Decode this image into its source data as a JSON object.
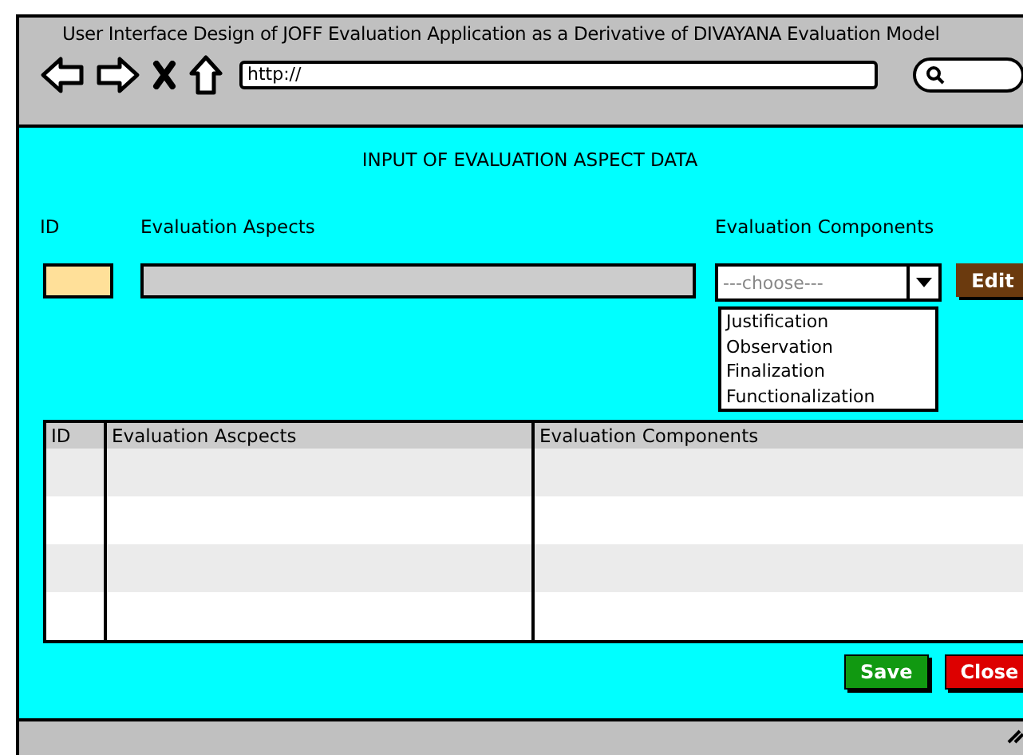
{
  "window": {
    "title": "User Interface Design of JOFF Evaluation Application as a Derivative of DIVAYANA Evaluation Model"
  },
  "browser": {
    "url": "http://"
  },
  "form": {
    "heading": "INPUT OF EVALUATION ASPECT DATA",
    "labels": [
      "ID",
      "Evaluation Aspects",
      "Evaluation Components"
    ],
    "component_select": {
      "placeholder": "---choose---",
      "expanded": true,
      "options": [
        "Justification",
        "Observation",
        "Finalization",
        "Functionalization"
      ]
    },
    "edit_button": "Edit"
  },
  "table": {
    "columns": [
      "ID",
      "Evaluation Ascpects",
      "Evaluation Components"
    ]
  },
  "buttons": [
    {
      "label": "Save",
      "kind": "save"
    },
    {
      "label": "Close",
      "kind": "close"
    }
  ]
}
